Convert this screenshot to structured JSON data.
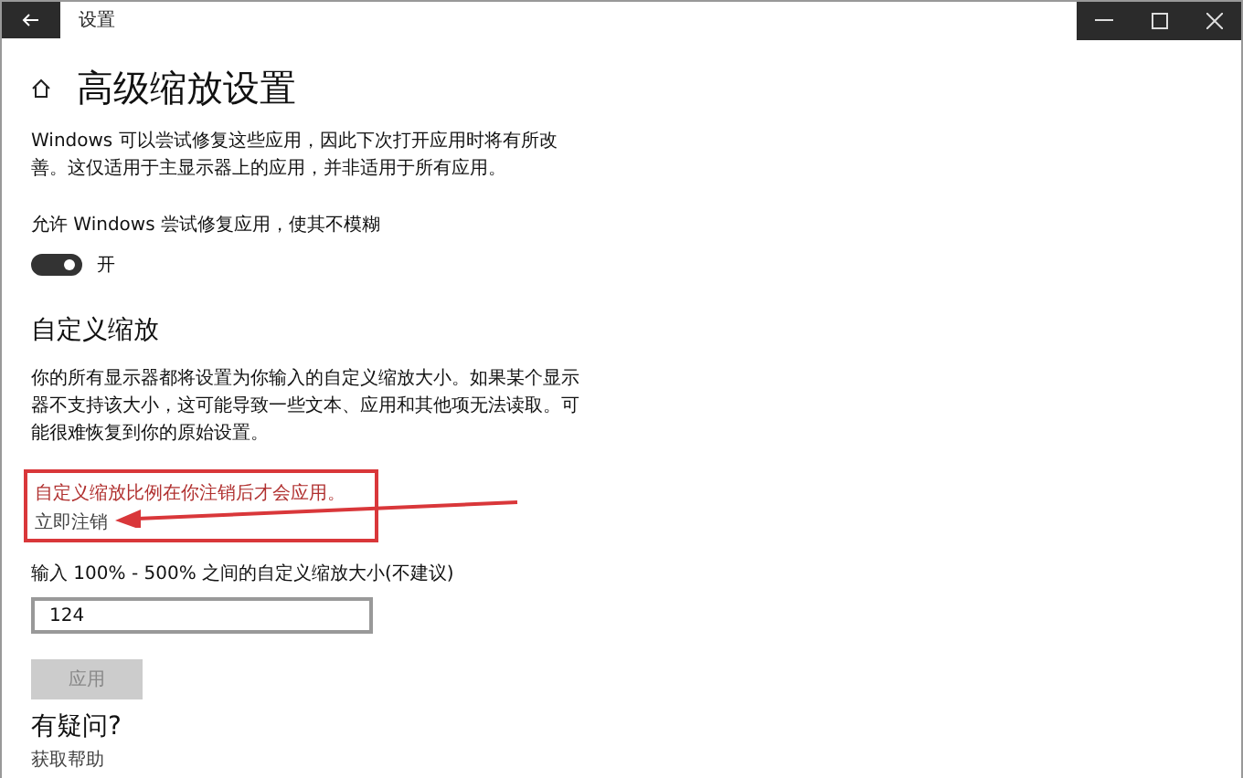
{
  "window": {
    "title": "设置"
  },
  "header": {
    "title": "高级缩放设置"
  },
  "intro": "Windows 可以尝试修复这些应用，因此下次打开应用时将有所改善。这仅适用于主显示器上的应用，并非适用于所有应用。",
  "fix_apps": {
    "label": "允许 Windows 尝试修复应用，使其不模糊",
    "on": true,
    "state_text": "开"
  },
  "custom_scaling": {
    "heading": "自定义缩放",
    "description": "你的所有显示器都将设置为你输入的自定义缩放大小。如果某个显示器不支持该大小，这可能导致一些文本、应用和其他项无法读取。可能很难恢复到你的原始设置。",
    "notice": "自定义缩放比例在你注销后才会应用。",
    "signout_link": "立即注销",
    "input_label": "输入 100% - 500% 之间的自定义缩放大小(不建议)",
    "input_value": "124",
    "apply_button": {
      "label": "应用",
      "disabled": true
    }
  },
  "help": {
    "heading": "有疑问?",
    "link": "获取帮助"
  }
}
